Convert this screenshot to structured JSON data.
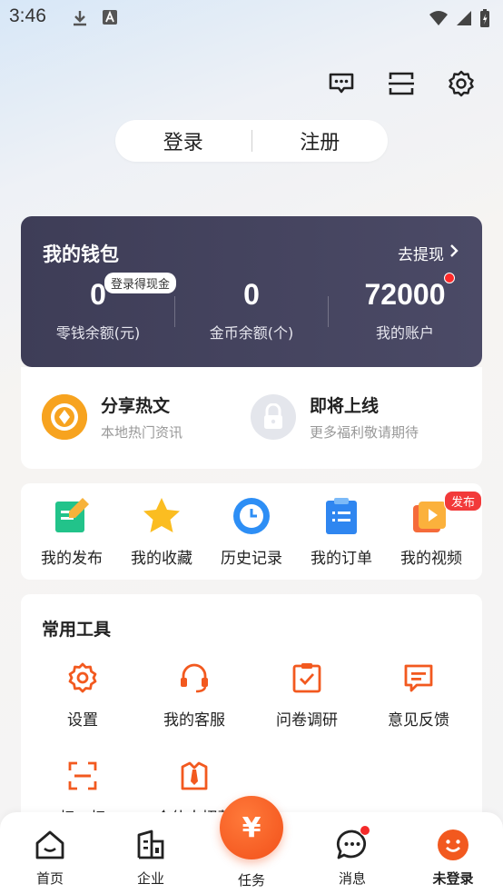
{
  "status_bar": {
    "time": "3:46"
  },
  "auth": {
    "login": "登录",
    "register": "注册"
  },
  "wallet": {
    "title": "我的钱包",
    "withdraw": "去提现",
    "cash_badge": "登录得现金",
    "items": [
      {
        "value": "0",
        "label": "零钱余额(元)"
      },
      {
        "value": "0",
        "label": "金币余额(个)"
      },
      {
        "value": "72000",
        "label": "我的账户"
      }
    ]
  },
  "share": [
    {
      "title": "分享热文",
      "subtitle": "本地热门资讯"
    },
    {
      "title": "即将上线",
      "subtitle": "更多福利敬请期待"
    }
  ],
  "quick": {
    "items": [
      {
        "label": "我的发布",
        "icon": "edit-doc-icon"
      },
      {
        "label": "我的收藏",
        "icon": "star-icon"
      },
      {
        "label": "历史记录",
        "icon": "clock-icon"
      },
      {
        "label": "我的订单",
        "icon": "clipboard-icon"
      },
      {
        "label": "我的视频",
        "icon": "video-icon"
      }
    ],
    "publish_badge": "发布"
  },
  "tools": {
    "title": "常用工具",
    "items": [
      {
        "label": "设置",
        "icon": "gear-icon"
      },
      {
        "label": "我的客服",
        "icon": "headset-icon"
      },
      {
        "label": "问卷调研",
        "icon": "survey-icon"
      },
      {
        "label": "意见反馈",
        "icon": "feedback-icon"
      },
      {
        "label": "扫一扫",
        "icon": "scan-icon"
      },
      {
        "label": "合伙人招募",
        "icon": "partner-icon"
      }
    ]
  },
  "tabbar": {
    "home": "首页",
    "enterprise": "企业",
    "task": "任务",
    "task_symbol": "¥",
    "messages": "消息",
    "me": "未登录"
  },
  "colors": {
    "accent": "#f2501a",
    "wallet_bg": "#3e3d57",
    "badge_red": "#f23a3a"
  }
}
